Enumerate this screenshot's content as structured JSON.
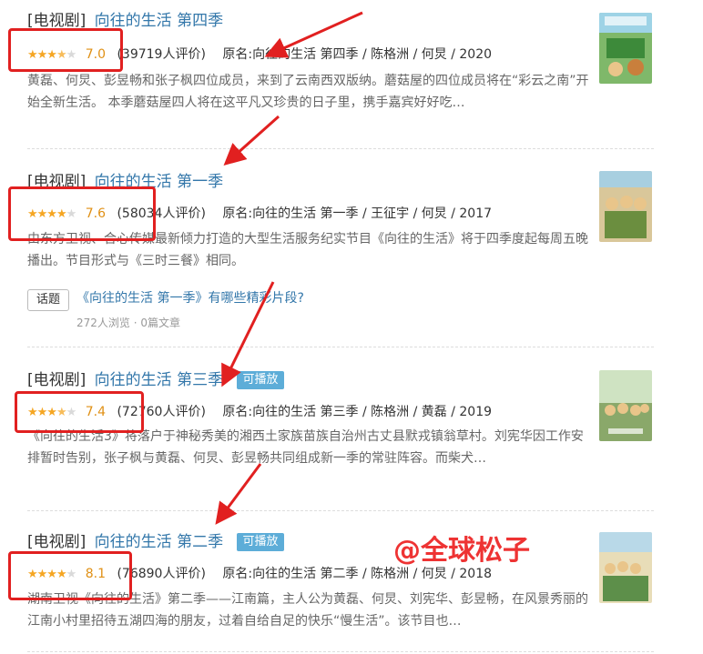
{
  "items": [
    {
      "category": "[电视剧]",
      "title_main": "向往的生活",
      "title_season": "第四季",
      "playable": "",
      "stars": 3.5,
      "score": "7.0",
      "count": "(39719人评价)",
      "original": "原名:向往的生活 第四季 / 陈格洲 / 何炅 / 2020",
      "desc": "黄磊、何炅、彭昱畅和张子枫四位成员，来到了云南西双版纳。蘑菇屋的四位成员将在“彩云之南”开始全新生活。 本季蘑菇屋四人将在这平凡又珍贵的日子里，携手嘉宾好好吃…"
    },
    {
      "category": "[电视剧]",
      "title_main": "向往的生活",
      "title_season": "第一季",
      "playable": "",
      "stars": 4,
      "score": "7.6",
      "count": "(58034人评价)",
      "original": "原名:向往的生活 第一季 / 王征宇 / 何炅 / 2017",
      "desc": "由东方卫视、合心传媒最新倾力打造的大型生活服务纪实节目《向往的生活》将于四季度起每周五晚播出。节目形式与《三时三餐》相同。"
    },
    {
      "category": "[电视剧]",
      "title_main": "向往的生活",
      "title_season": "第三季",
      "playable": "可播放",
      "stars": 3.5,
      "score": "7.4",
      "count": "(72760人评价)",
      "original": "原名:向往的生活 第三季 / 陈格洲 / 黄磊 / 2019",
      "desc": "《向往的生活3》将落户于神秘秀美的湘西土家族苗族自治州古丈县默戎镇翁草村。刘宪华因工作安排暂时告别，张子枫与黄磊、何炅、彭昱畅共同组成新一季的常驻阵容。而柴犬…"
    },
    {
      "category": "[电视剧]",
      "title_main": "向往的生活",
      "title_season": "第二季",
      "playable": "可播放",
      "stars": 4,
      "score": "8.1",
      "count": "(76890人评价)",
      "original": "原名:向往的生活 第二季 / 陈格洲 / 何炅 / 2018",
      "desc": "湖南卫视《向往的生活》第二季——江南篇，主人公为黄磊、何炅、刘宪华、彭昱畅，在风景秀丽的江南小村里招待五湖四海的朋友，过着自给自足的快乐“慢生活”。该节目也…"
    }
  ],
  "topic": {
    "tag": "话题",
    "title": "《向往的生活  第一季》有哪些精彩片段?",
    "stats": "272人浏览 · 0篇文章"
  },
  "watermark": "@全球松子",
  "colors": {
    "link": "#3377aa",
    "star": "#f5a623",
    "score": "#e09015",
    "annotation_red": "#e12020",
    "badge": "#5dadd8"
  }
}
